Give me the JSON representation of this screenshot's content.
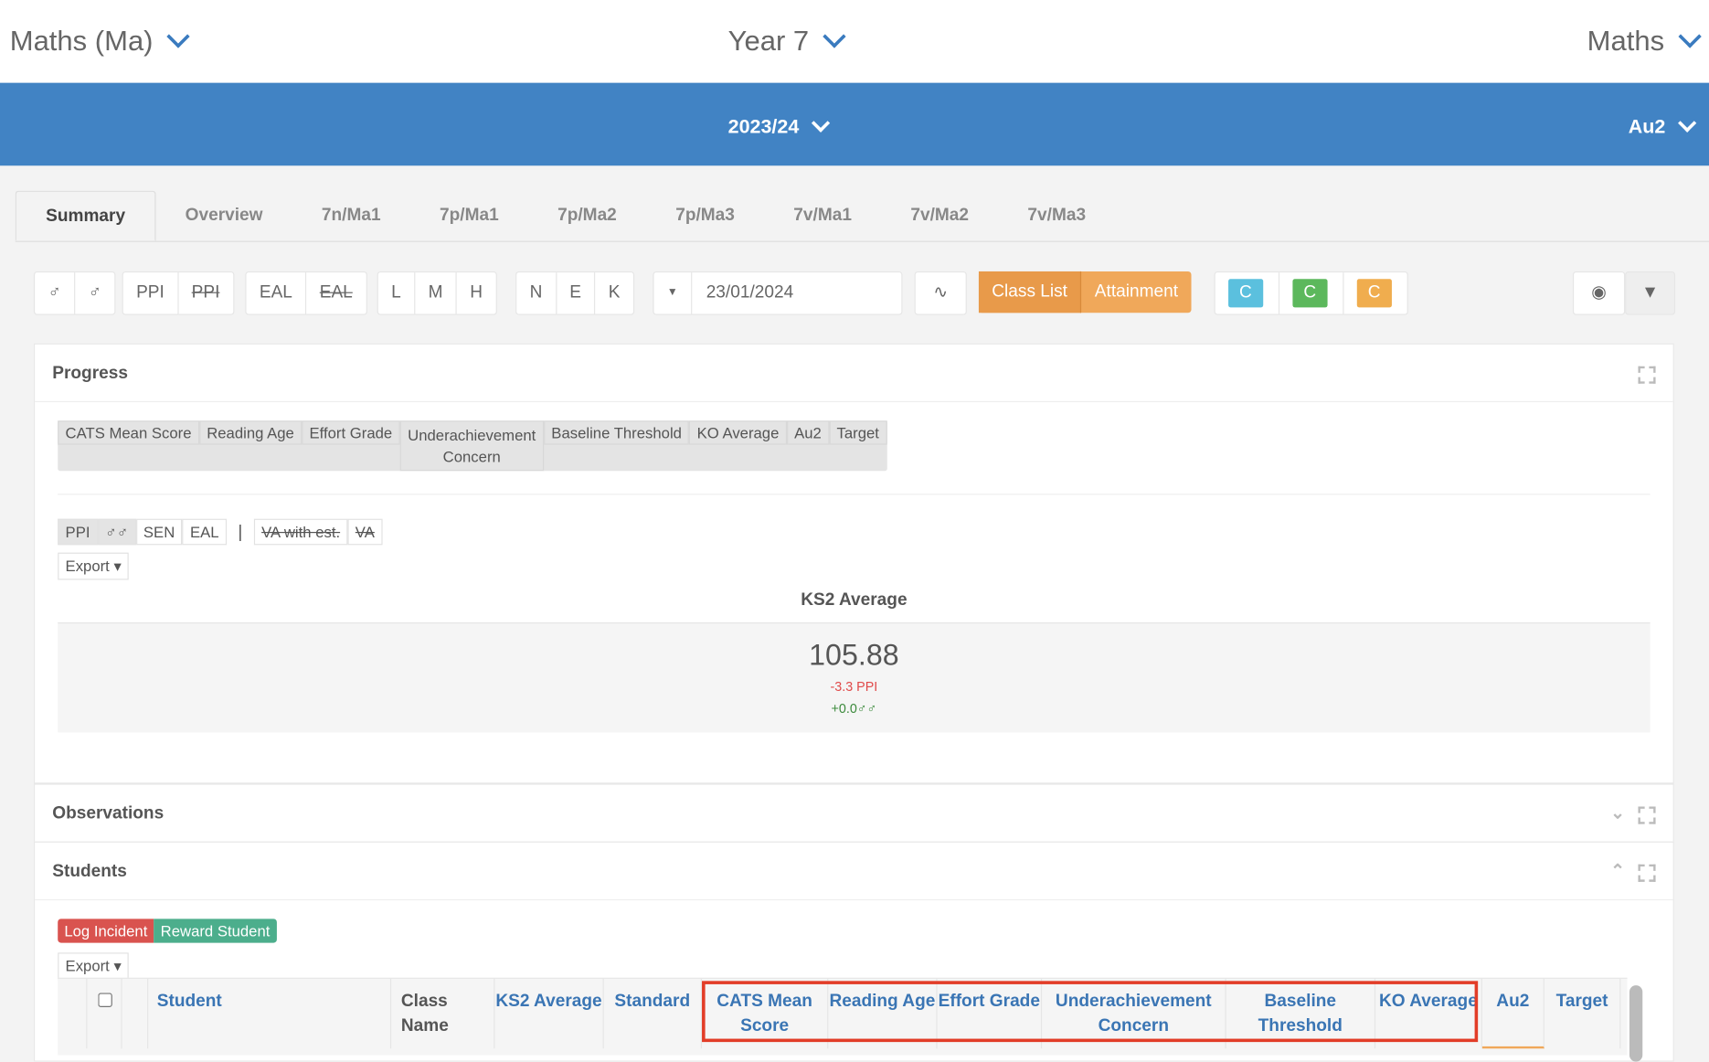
{
  "top": {
    "subject_select": "Maths (Ma)",
    "year_select": "Year 7",
    "dept_select": "Maths"
  },
  "band": {
    "year": "2023/24",
    "term": "Au2"
  },
  "tabs": [
    "Summary",
    "Overview",
    "7n/Ma1",
    "7p/Ma1",
    "7p/Ma2",
    "7p/Ma3",
    "7v/Ma1",
    "7v/Ma2",
    "7v/Ma3"
  ],
  "toolbar": {
    "ppi": "PPI",
    "ppi_off": "PPI",
    "eal": "EAL",
    "eal_off": "EAL",
    "lmh": [
      "L",
      "M",
      "H"
    ],
    "nek": [
      "N",
      "E",
      "K"
    ],
    "date": "23/01/2024",
    "class_list": "Class List",
    "attainment": "Attainment",
    "c": "C"
  },
  "colors": {
    "accent": "#4183c4",
    "orange": "#f0a85a",
    "teal": "#5bc0de",
    "green": "#5cb85c",
    "log": "#d9534f",
    "reward": "#4cae8c"
  },
  "progress": {
    "title": "Progress",
    "columns": [
      "CATS Mean Score",
      "Reading Age",
      "Effort Grade",
      "Underachievement Concern",
      "Baseline Threshold",
      "KO Average",
      "Au2",
      "Target"
    ],
    "filters": [
      "PPI",
      "SEN",
      "EAL"
    ],
    "va": [
      "VA with est.",
      "VA"
    ],
    "export": "Export",
    "metric_title": "KS2 Average",
    "metric_value": "105.88",
    "ppi_diff": "-3.3 PPI",
    "gender_diff": "+0.0"
  },
  "observations": {
    "title": "Observations"
  },
  "students": {
    "title": "Students",
    "log_incident": "Log Incident",
    "reward_student": "Reward Student",
    "export": "Export",
    "headers": [
      "Student",
      "Class Name",
      "KS2 Average",
      "Standard",
      "CATS Mean Score",
      "Reading Age",
      "Effort Grade",
      "Underachievement Concern",
      "Baseline Threshold",
      "KO Average",
      "Au2",
      "Target"
    ]
  }
}
